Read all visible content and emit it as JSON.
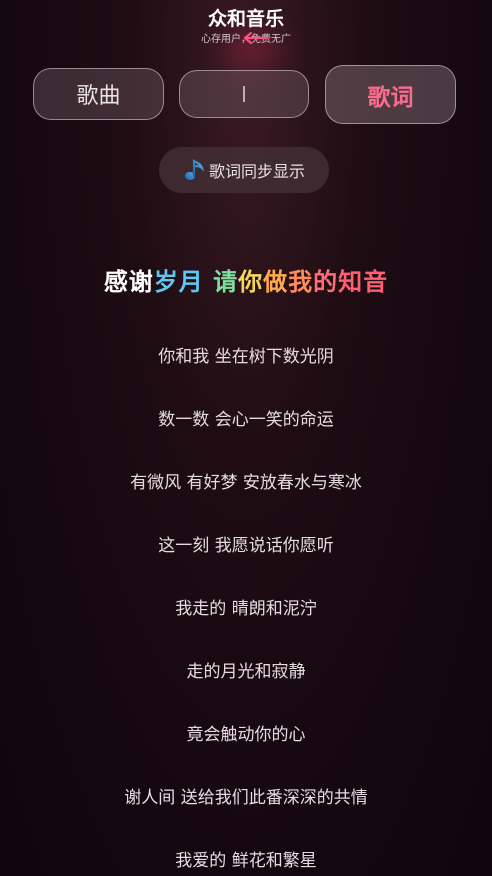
{
  "app": {
    "title": "众和音乐",
    "subtitle": "心存用户，免费无广"
  },
  "mode_buttons": {
    "song_label": "歌曲",
    "middle_label": "",
    "lyrics_label": "歌词"
  },
  "sync_button": {
    "label": "歌词同步显示",
    "icon": "music-note-icon"
  },
  "lyrics": {
    "title_segments": [
      {
        "text": "感谢",
        "color": "#ffffff"
      },
      {
        "text": "岁月 ",
        "color": "#5ec9f0"
      },
      {
        "text": "请",
        "color": "#7fe0a0"
      },
      {
        "text": "你",
        "color": "#f2d75a"
      },
      {
        "text": "做",
        "color": "#ffa94d"
      },
      {
        "text": "我",
        "color": "#ff8a5c"
      },
      {
        "text": "的",
        "color": "#ff6f7a"
      },
      {
        "text": "知音",
        "color": "#ff5f73"
      }
    ],
    "lines": [
      "你和我 坐在树下数光阴",
      "数一数 会心一笑的命运",
      "有微风 有好梦 安放春水与寒冰",
      "这一刻 我愿说话你愿听",
      "我走的 晴朗和泥泞",
      "走的月光和寂静",
      "竟会触动你的心",
      "谢人间 送给我们此番深深的共情",
      "我爱的 鲜花和繁星"
    ]
  },
  "colors": {
    "accent": "#ff6b8f",
    "background": "#1e0c12"
  }
}
